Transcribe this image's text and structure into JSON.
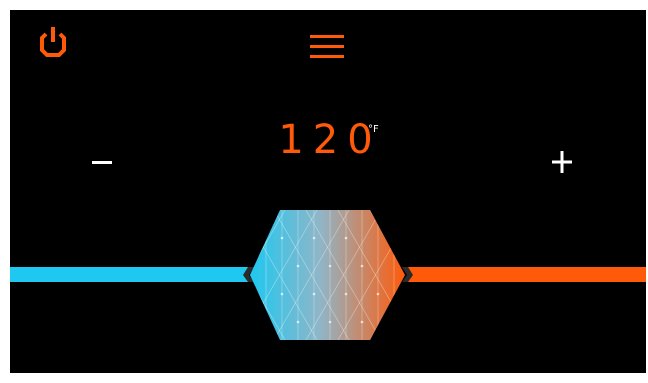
{
  "thermostat": {
    "temperature": "120",
    "unit": "°F",
    "level": 0.5
  },
  "icons": {
    "power": "power-icon",
    "menu": "hamburger-menu-icon",
    "decrease": "minus-icon",
    "increase": "plus-icon"
  },
  "colors": {
    "background": "#000000",
    "accent": "#ff5a0a",
    "cool": "#1ec8f0",
    "warm": "#ff5a0a",
    "control": "#ffffff"
  }
}
